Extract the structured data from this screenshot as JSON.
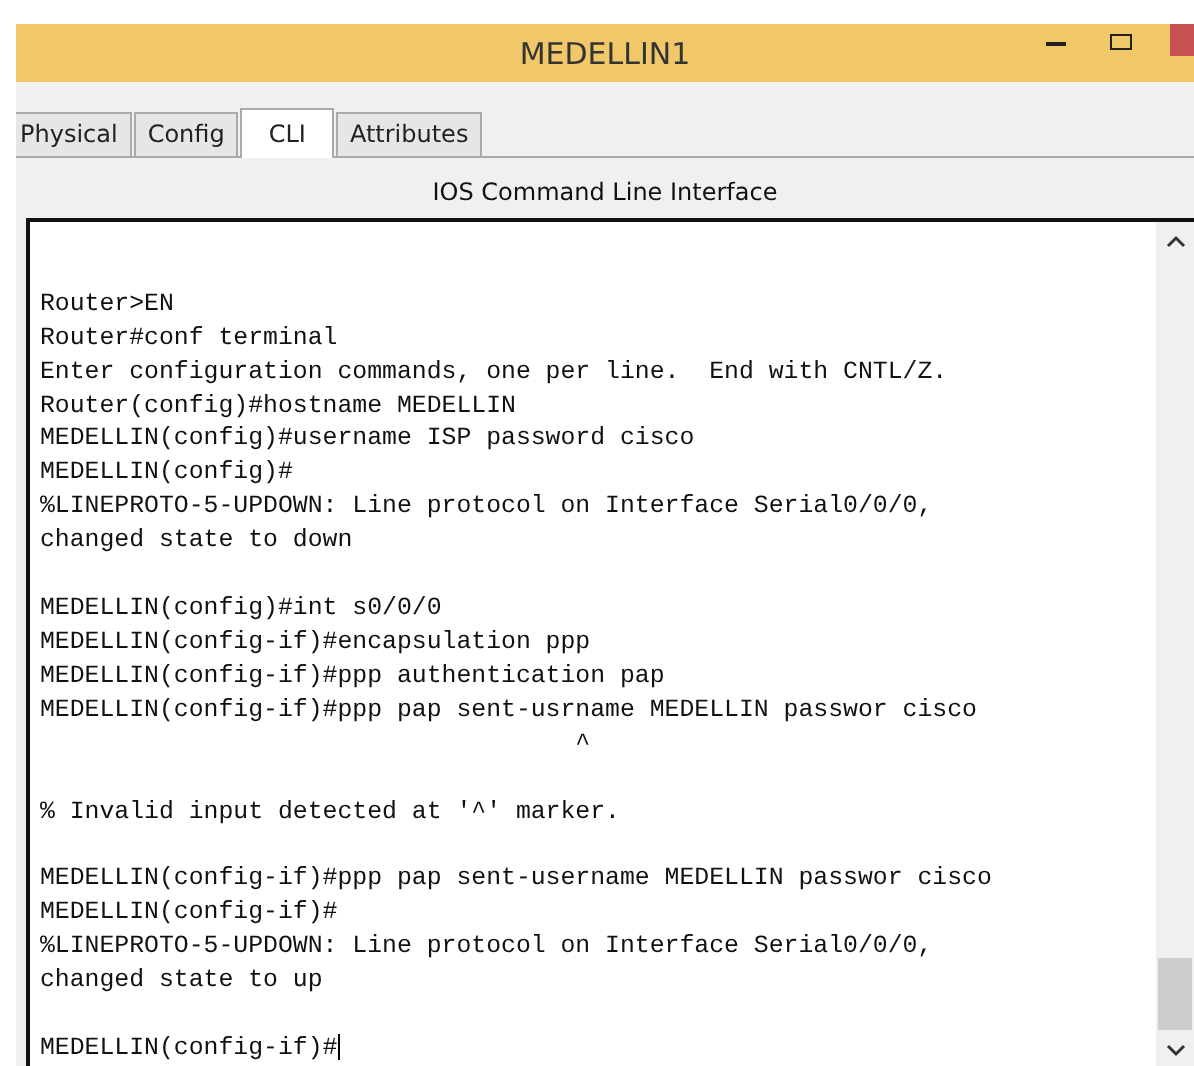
{
  "window": {
    "title": "MEDELLIN1"
  },
  "tabs": [
    {
      "label": "Physical",
      "selected": false
    },
    {
      "label": "Config",
      "selected": false
    },
    {
      "label": "CLI",
      "selected": true
    },
    {
      "label": "Attributes",
      "selected": false
    }
  ],
  "panel_title": "IOS Command Line Interface",
  "terminal": {
    "blocks": [
      [
        "Router>EN",
        "Router#conf terminal",
        "Enter configuration commands, one per line.  End with CNTL/Z.",
        "Router(config)#hostname MEDELLIN",
        "MEDELLIN(config)#username ISP password cisco",
        "MEDELLIN(config)#",
        "%LINEPROTO-5-UPDOWN: Line protocol on Interface Serial0/0/0,",
        "changed state to down"
      ],
      [
        "MEDELLIN(config)#int s0/0/0",
        "MEDELLIN(config-if)#encapsulation ppp",
        "MEDELLIN(config-if)#ppp authentication pap",
        "MEDELLIN(config-if)#ppp pap sent-usrname MEDELLIN passwor cisco",
        "                                    ^"
      ],
      [
        "% Invalid input detected at '^' marker."
      ],
      [
        "MEDELLIN(config-if)#ppp pap sent-username MEDELLIN passwor cisco",
        "MEDELLIN(config-if)#",
        "%LINEPROTO-5-UPDOWN: Line protocol on Interface Serial0/0/0,",
        "changed state to up"
      ],
      [
        "MEDELLIN(config-if)#"
      ]
    ]
  }
}
